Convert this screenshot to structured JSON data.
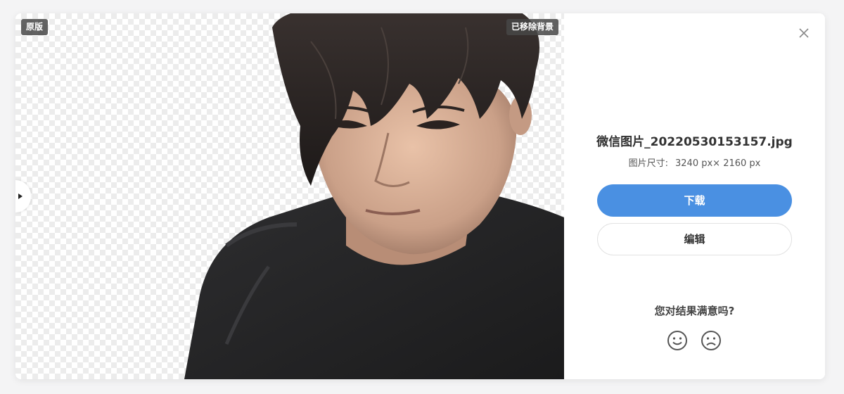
{
  "preview": {
    "tag_original": "原版",
    "tag_removed": "已移除背景"
  },
  "file": {
    "name": "微信图片_20220530153157.jpg",
    "size_label": "图片尺寸:",
    "size_value": "3240 px× 2160 px"
  },
  "actions": {
    "download_label": "下载",
    "edit_label": "编辑"
  },
  "feedback": {
    "question": "您对结果满意吗?",
    "icons": [
      "smile-icon",
      "frown-icon"
    ]
  },
  "colors": {
    "primary": "#4a90e2",
    "tag_bg": "#464646"
  }
}
